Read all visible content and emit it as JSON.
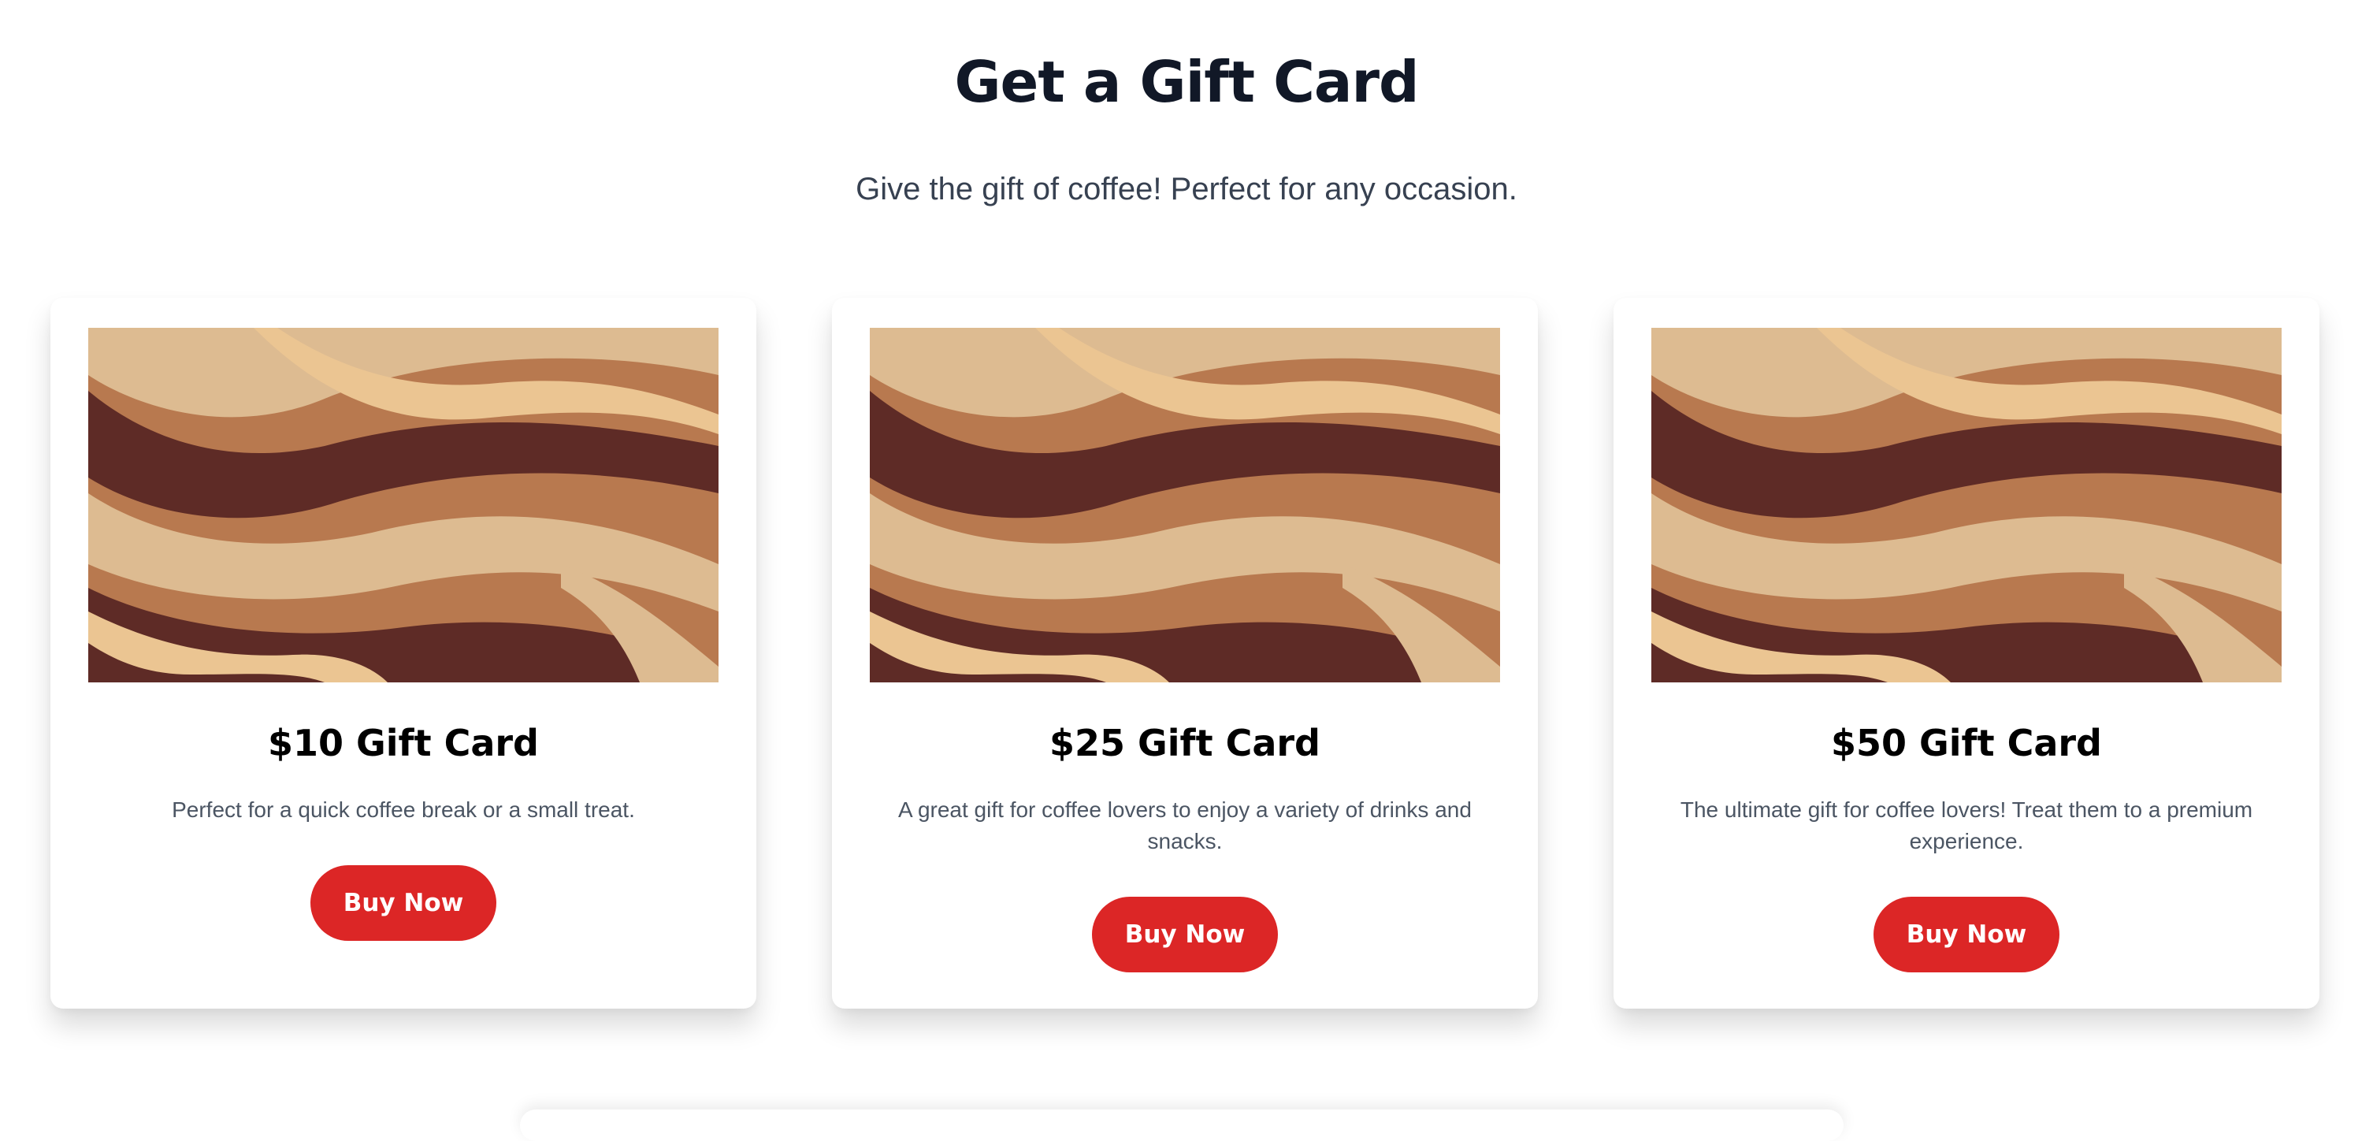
{
  "header": {
    "title": "Get a Gift Card",
    "subtitle": "Give the gift of coffee! Perfect for any occasion."
  },
  "colors": {
    "button": "#dc2626",
    "title": "#111827",
    "swirl_dark": "#5e2b26",
    "swirl_mid": "#b8794f",
    "swirl_light": "#ddbb91",
    "swirl_pale": "#ebc592"
  },
  "cards": [
    {
      "title": "$10 Gift Card",
      "description": "Perfect for a quick coffee break or a small treat.",
      "button": "Buy Now"
    },
    {
      "title": "$25 Gift Card",
      "description": "A great gift for coffee lovers to enjoy a variety of drinks and snacks.",
      "button": "Buy Now"
    },
    {
      "title": "$50 Gift Card",
      "description": "The ultimate gift for coffee lovers! Treat them to a premium experience.",
      "button": "Buy Now"
    }
  ]
}
